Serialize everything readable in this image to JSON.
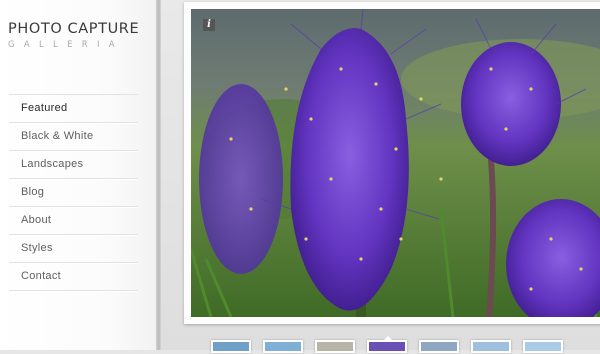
{
  "logo": {
    "title": "PHOTO CAPTURE",
    "subtitle": "GALLERIA"
  },
  "nav": {
    "items": [
      {
        "label": "Featured",
        "active": true
      },
      {
        "label": "Black & White",
        "active": false
      },
      {
        "label": "Landscapes",
        "active": false
      },
      {
        "label": "Blog",
        "active": false
      },
      {
        "label": "About",
        "active": false
      },
      {
        "label": "Styles",
        "active": false
      },
      {
        "label": "Contact",
        "active": false
      }
    ]
  },
  "gallery": {
    "info_label": "i",
    "info_icon": "info-icon",
    "photo_subject": "purple-flowers",
    "active_thumb": 3,
    "thumbs": [
      {
        "color": "#6fa0c8"
      },
      {
        "color": "#7fb0d4"
      },
      {
        "color": "#b8b4aa"
      },
      {
        "color": "#6a4fb5"
      },
      {
        "color": "#8fa7c0"
      },
      {
        "color": "#9ec0de"
      },
      {
        "color": "#aacbe6"
      }
    ]
  },
  "colors": {
    "flower": "#6a3fc8",
    "flower_dark": "#3f1f8f",
    "background_green": "#5f8b3a"
  }
}
